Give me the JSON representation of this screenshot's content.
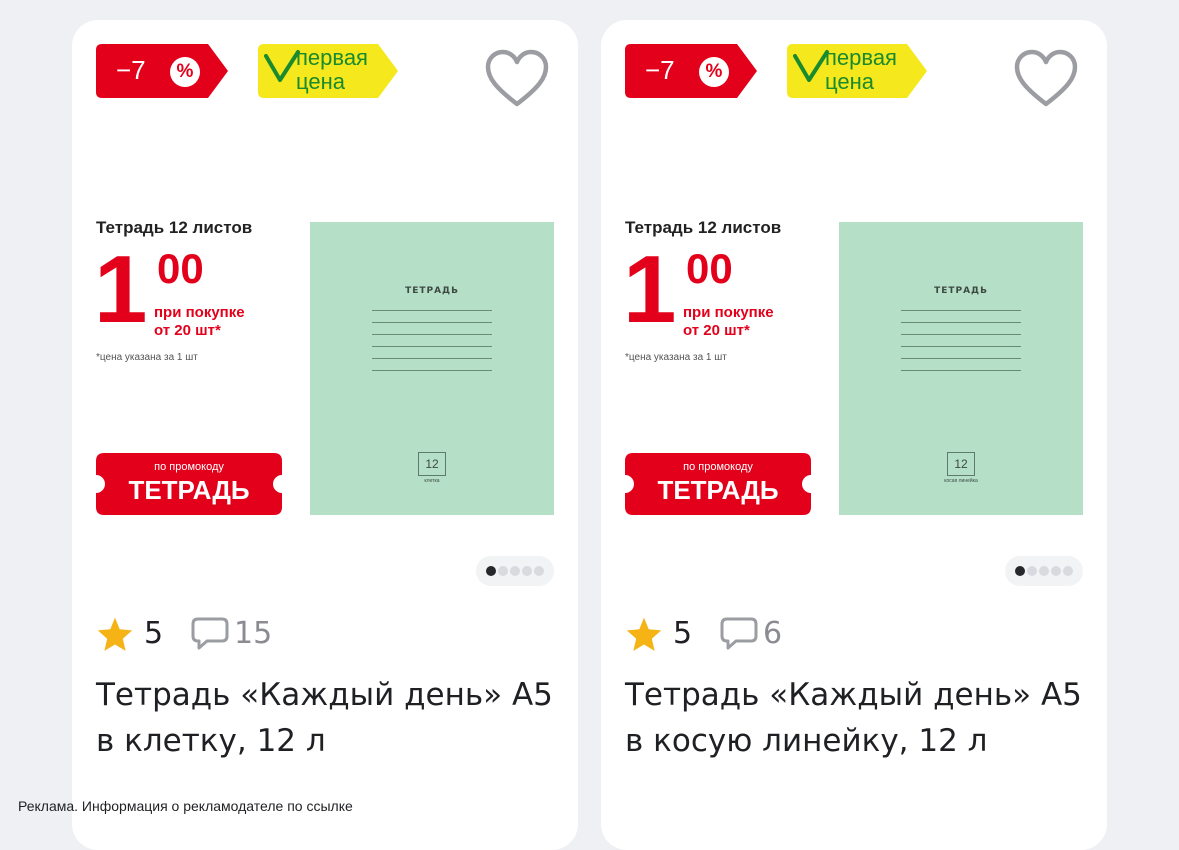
{
  "colors": {
    "background": "#eff0f3",
    "card": "#ffffff",
    "discount_red": "#e3001b",
    "price_yellow": "#f5e81c",
    "price_green": "#1a8a2e",
    "star": "#f5b316"
  },
  "cards": [
    {
      "discount": {
        "text": "−7",
        "percent": "%"
      },
      "badge": {
        "line1": "первая",
        "line2": "цена"
      },
      "banner": {
        "title": "Тетрадь 12 листов",
        "price_int": "1",
        "price_cents": "00",
        "promo_line1": "при покупке",
        "promo_line2": "от 20 шт*",
        "note": "*цена указана за 1 шт",
        "coupon_small": "по промокоду",
        "coupon_big": "ТЕТРАДЬ",
        "notebook_title": "ТЕТРАДЬ",
        "notebook_count": "12",
        "notebook_sub": "клетка"
      },
      "rating": "5",
      "reviews": "15",
      "title": "Тетрадь «Каждый день» А5 в клетку, 12 л"
    },
    {
      "discount": {
        "text": "−7",
        "percent": "%"
      },
      "badge": {
        "line1": "первая",
        "line2": "цена"
      },
      "banner": {
        "title": "Тетрадь 12 листов",
        "price_int": "1",
        "price_cents": "00",
        "promo_line1": "при покупке",
        "promo_line2": "от 20 шт*",
        "note": "*цена указана за 1 шт",
        "coupon_small": "по промокоду",
        "coupon_big": "ТЕТРАДЬ",
        "notebook_title": "ТЕТРАДЬ",
        "notebook_count": "12",
        "notebook_sub": "косая линейка"
      },
      "rating": "5",
      "reviews": "6",
      "title": "Тетрадь «Каждый день» А5 в косую линейку, 12 л"
    }
  ],
  "ad_note": "Реклама. Информация о рекламодателе по ссылке"
}
